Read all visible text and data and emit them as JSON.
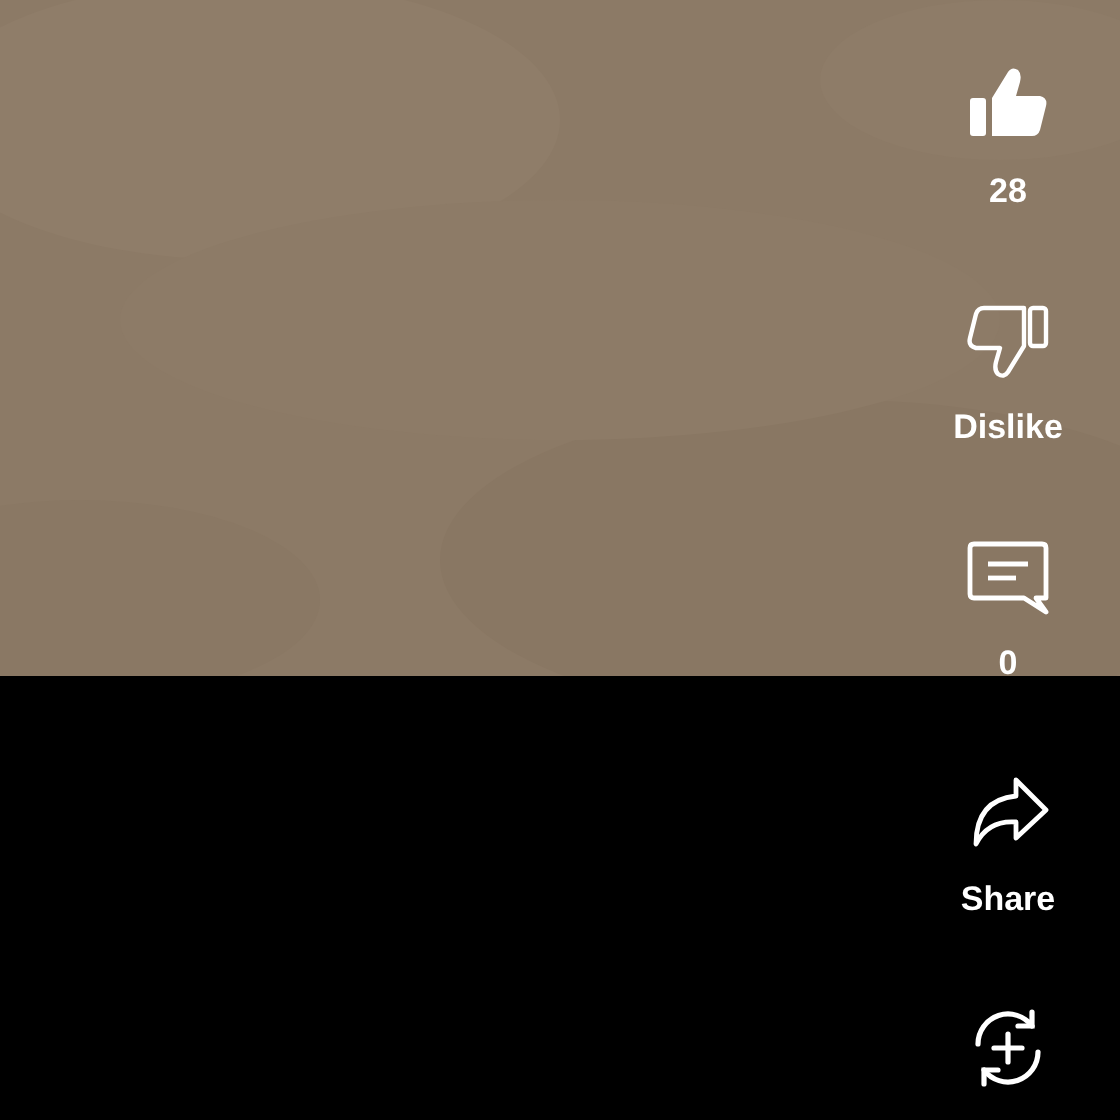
{
  "actions": [
    {
      "kind": "like",
      "label": "28",
      "selected": true
    },
    {
      "kind": "dislike",
      "label": "Dislike",
      "selected": false
    },
    {
      "kind": "comment",
      "label": "0"
    },
    {
      "kind": "share",
      "label": "Share"
    },
    {
      "kind": "remix"
    }
  ]
}
